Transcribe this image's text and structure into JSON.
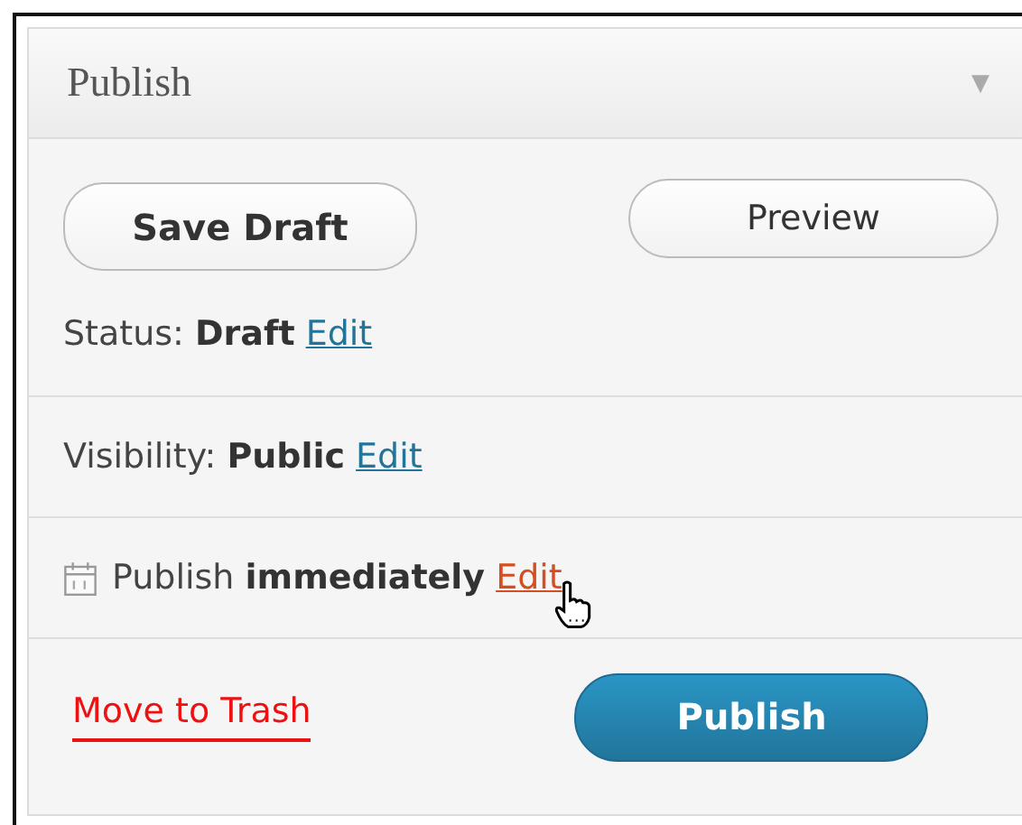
{
  "panel": {
    "title": "Publish",
    "collapse_glyph": "▼"
  },
  "actions": [
    {
      "label": "Save Draft",
      "kind": "secondary-bold"
    },
    {
      "label": "Preview",
      "kind": "secondary"
    }
  ],
  "rows": [
    {
      "kind": "plain",
      "text": "Status: **Draft**",
      "link": {
        "label": "Edit",
        "hovered": false
      }
    },
    {
      "kind": "plain",
      "text": "Visibility: **Public**",
      "link": {
        "label": "Edit",
        "hovered": false
      }
    },
    {
      "kind": "dated",
      "text": "Publish **immediately**",
      "link": {
        "label": "Edit",
        "hovered": true
      }
    }
  ],
  "footer": {
    "trash_link": "Move to Trash",
    "publish_button": "Publish"
  }
}
